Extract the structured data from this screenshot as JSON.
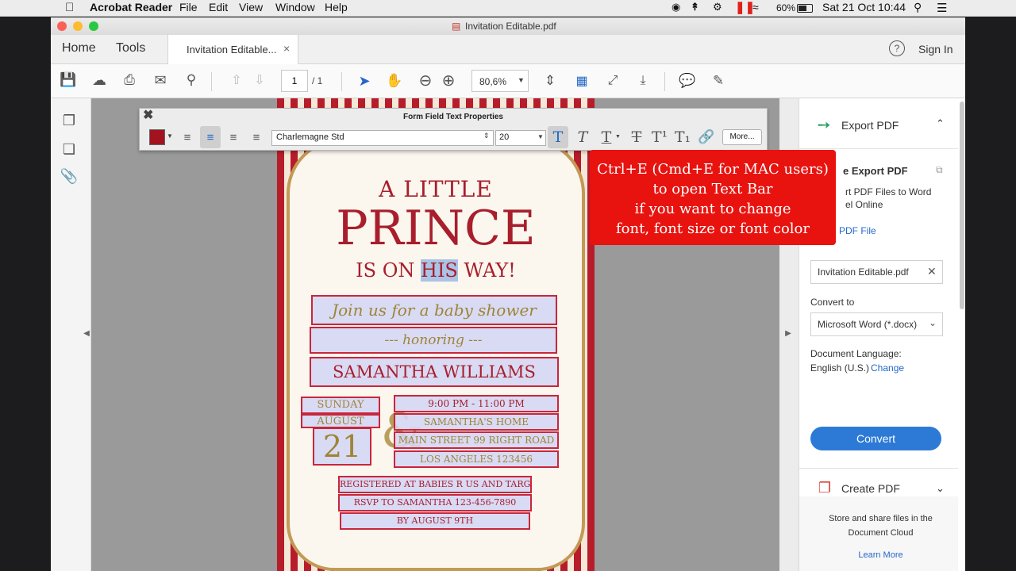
{
  "menubar": {
    "app": "Acrobat Reader",
    "items": [
      "File",
      "Edit",
      "View",
      "Window",
      "Help"
    ],
    "battery": "60%",
    "datetime": "Sat 21 Oct  10:44"
  },
  "window": {
    "title": "Invitation Editable.pdf"
  },
  "tabs": {
    "home": "Home",
    "tools": "Tools",
    "doc": "Invitation Editable...",
    "close": "×",
    "signin": "Sign In",
    "help": "?"
  },
  "toolbar": {
    "page_current": "1",
    "page_total": "/  1",
    "zoom": "80,6%"
  },
  "textprops": {
    "title": "Form Field Text Properties",
    "font": "Charlemagne Std",
    "size": "20",
    "more": "More...",
    "color": "#a2131f"
  },
  "invitation": {
    "line1": "A LITTLE",
    "line2": "PRINCE",
    "line3_pre": "IS ON ",
    "line3_sel": "HIS",
    "line3_post": " WAY!",
    "join": "Join us for a baby shower",
    "honoring": "--- honoring ---",
    "name": "SAMANTHA  WILLIAMS",
    "day": "SUNDAY",
    "month": "AUGUST",
    "date": "21",
    "time": "9:00 PM - 11:00 PM",
    "venue": "SAMANTHA'S HOME",
    "street": "MAIN STREET 99 RIGHT ROAD",
    "city": "LOS ANGELES 123456",
    "registry": "REGISTERED AT BABIES R US AND TARGET",
    "rsvp": "RSVP TO SAMANTHA 123-456-7890",
    "deadline": "BY AUGUST 9TH"
  },
  "callout": {
    "line1": "Ctrl+E (Cmd+E for MAC users)",
    "line2": "to open Text Bar",
    "line3": "if you want to change",
    "line4": "font, font size or font color"
  },
  "panel": {
    "export_header": "Export PDF",
    "export_title": "e Export PDF",
    "desc1": "rt PDF Files to Word",
    "desc2": "el Online",
    "select_link": "PDF File",
    "file": "Invitation Editable.pdf",
    "convert_to": "Convert to",
    "format": "Microsoft Word (*.docx)",
    "lang_label": "Document Language:",
    "lang_value": "English (U.S.)",
    "lang_change": "Change",
    "convert_btn": "Convert",
    "create_header": "Create PDF",
    "store1": "Store and share files in the",
    "store2": "Document Cloud",
    "learn": "Learn More"
  },
  "colors": {
    "accent": "#2d7ad6",
    "invite_red": "#a81e2c",
    "gold": "#9e8436",
    "callout": "#e8130f"
  }
}
